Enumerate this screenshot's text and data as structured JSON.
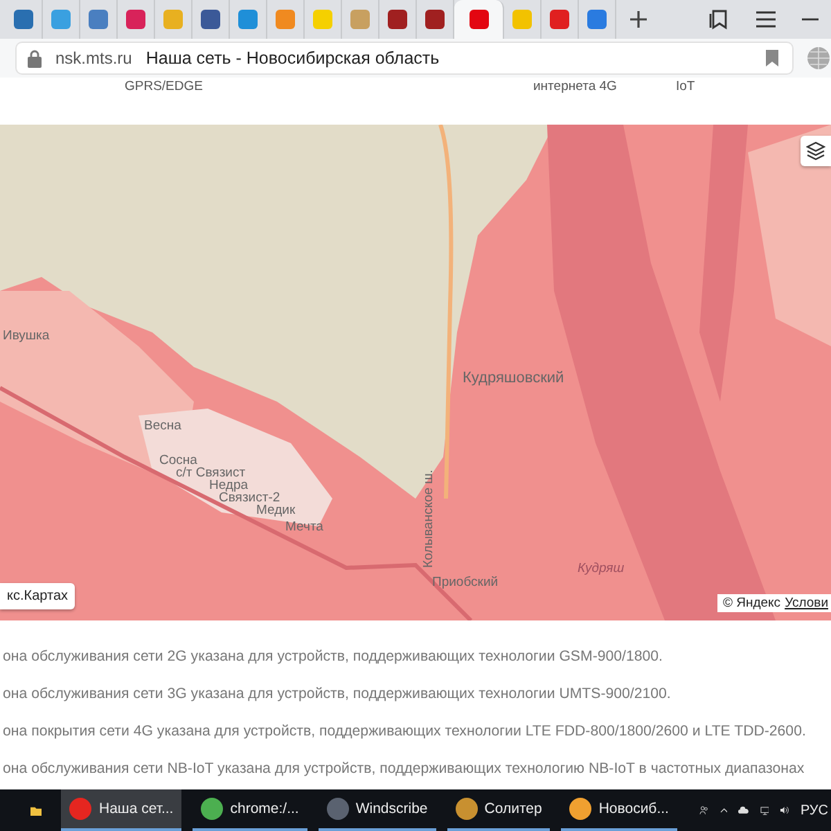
{
  "browser": {
    "tabs": [
      {
        "color": "#2a6fb0",
        "selected": false
      },
      {
        "color": "#3aa0e0",
        "selected": false
      },
      {
        "color": "#4a7fc0",
        "selected": false
      },
      {
        "color": "#d8235a",
        "selected": false
      },
      {
        "color": "#e8b020",
        "selected": false
      },
      {
        "color": "#3b5998",
        "selected": false
      },
      {
        "color": "#1f8fd8",
        "selected": false
      },
      {
        "color": "#f08a20",
        "selected": false
      },
      {
        "color": "#f5d000",
        "selected": false
      },
      {
        "color": "#c8a060",
        "selected": false
      },
      {
        "color": "#a02020",
        "selected": false
      },
      {
        "color": "#a02020",
        "selected": false
      },
      {
        "color": "#e30611",
        "selected": true
      },
      {
        "color": "#f2c200",
        "selected": false
      },
      {
        "color": "#e02020",
        "selected": false
      },
      {
        "color": "#2a7be0",
        "selected": false
      }
    ],
    "domain": "nsk.mts.ru",
    "page_title": "Наша сеть - Новосибирская область"
  },
  "table_fragment": [
    "GPRS/EDGE",
    "интернета 4G",
    "IoT"
  ],
  "map": {
    "labels": [
      {
        "text": "Ивушка",
        "kind": "place"
      },
      {
        "text": "Весна",
        "kind": "place"
      },
      {
        "text": "Сосна",
        "kind": "place"
      },
      {
        "text": "с/т Связист",
        "kind": "place"
      },
      {
        "text": "Недра",
        "kind": "place"
      },
      {
        "text": "Связист-2",
        "kind": "place"
      },
      {
        "text": "Медик",
        "kind": "place"
      },
      {
        "text": "Мечта",
        "kind": "place"
      },
      {
        "text": "Кудряшовский",
        "kind": "town"
      },
      {
        "text": "Приобский",
        "kind": "place"
      },
      {
        "text": "Кудряш",
        "kind": "water"
      },
      {
        "text": "Колыванское ш.",
        "kind": "road"
      }
    ],
    "open_link": "кс.Картах",
    "copyright": "© Яндекс",
    "terms_link": "Услови"
  },
  "notes": [
    "она обслуживания сети 2G указана для устройств, поддерживающих технологии GSM-900/1800.",
    "она обслуживания сети 3G указана для устройств, поддерживающих технологии UMTS-900/2100.",
    "она покрытия сети 4G указана для устройств, поддерживающих технологии LTE FDD-800/1800/2600 и LTE TDD-2600.",
    "она обслуживания сети NB-IoT указана для устройств, поддерживающих технологию NB-IoT в частотных диапазонах"
  ],
  "taskbar": {
    "apps": [
      {
        "label": "Наша сет...",
        "selected": true,
        "kind": "yandex"
      },
      {
        "label": "chrome:/...",
        "selected": false,
        "kind": "chrome"
      },
      {
        "label": "Windscribe",
        "selected": false,
        "kind": "windscribe"
      },
      {
        "label": "Солитер",
        "selected": false,
        "kind": "solitaire"
      },
      {
        "label": "Новосиб...",
        "selected": false,
        "kind": "map"
      }
    ],
    "language": "РУС"
  }
}
